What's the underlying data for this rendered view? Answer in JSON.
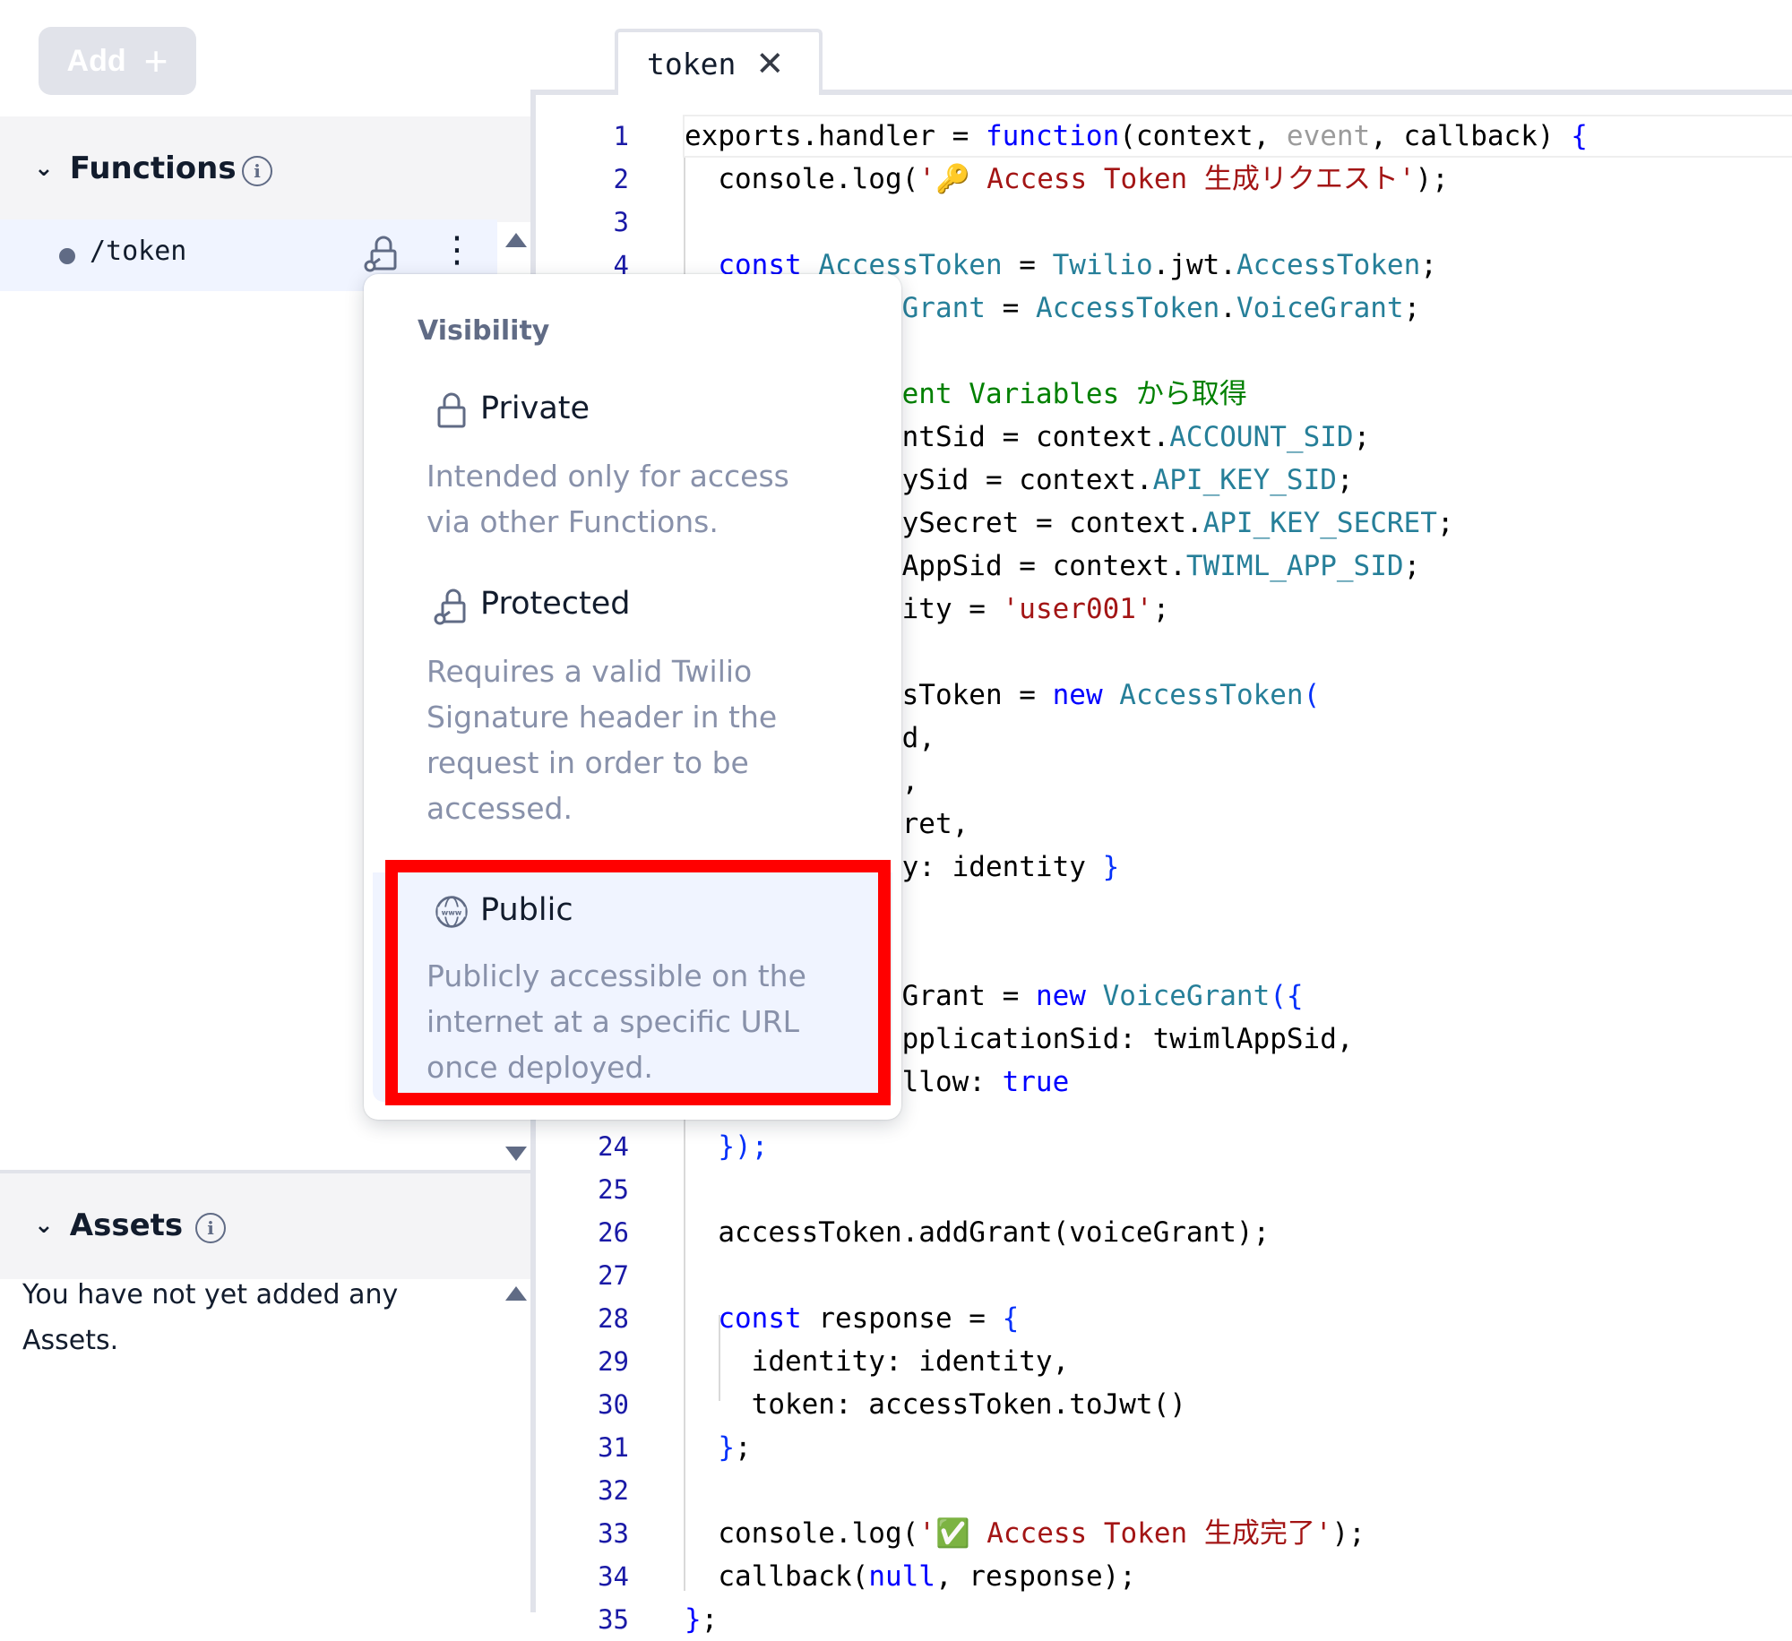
{
  "sidebar": {
    "add_label": "Add",
    "add_icon": "+",
    "functions_label": "Functions",
    "function_route": "/token",
    "assets_label": "Assets",
    "assets_empty": "You have not yet added any Assets."
  },
  "editor": {
    "tab_label": "token",
    "tab_close": "✕",
    "line_numbers": [
      "1",
      "2",
      "3",
      "4",
      "24",
      "25",
      "26",
      "27",
      "28",
      "29",
      "30",
      "31",
      "32",
      "33",
      "34",
      "35"
    ]
  },
  "popover": {
    "title": "Visibility",
    "private_label": "Private",
    "private_desc": "Intended only for access via other Functions.",
    "protected_label": "Protected",
    "protected_desc": "Requires a valid Twilio Signature header in the request in order to be accessed.",
    "public_label": "Public",
    "public_desc": "Publicly accessible on the internet at a specific URL once deployed.",
    "highlight_color": "#ff0000"
  }
}
